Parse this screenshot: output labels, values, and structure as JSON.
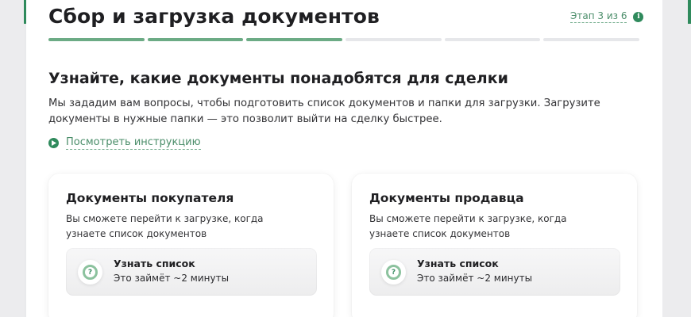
{
  "header": {
    "title": "Сбор и загрузка документов",
    "stage": "Этап 3 из 6",
    "progress": {
      "total": 6,
      "completed": 3
    }
  },
  "intro": {
    "heading": "Узнайте, какие документы понадобятся для сделки",
    "description": "Мы зададим вам вопросы, чтобы подготовить список документов и папки для загрузки. Загрузите документы в нужные папки — это позволит выйти на сделку быстрее.",
    "instruction_link": "Посмотреть инструкцию"
  },
  "cards": [
    {
      "title": "Документы покупателя",
      "text": "Вы сможете перейти к загрузке, когда узнаете список документов",
      "action_title": "Узнать список",
      "action_subtitle": "Это займёт ~2 минуты"
    },
    {
      "title": "Документы продавца",
      "text": "Вы сможете перейти к загрузке, когда узнаете список документов",
      "action_title": "Узнать список",
      "action_subtitle": "Это займёт ~2 минуты"
    }
  ],
  "colors": {
    "accent": "#2f8a5c",
    "link": "#4a8d69",
    "progress_done": "#6cab85",
    "progress_todo": "#e6e7ea"
  }
}
